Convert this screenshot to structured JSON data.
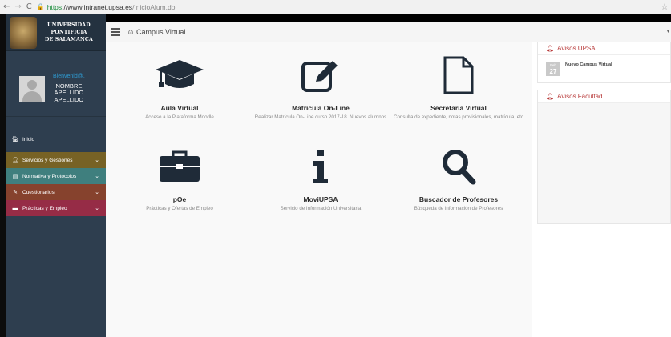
{
  "browser": {
    "back": "←",
    "forward": "→",
    "reload": "C",
    "url_scheme": "https",
    "url_host": "://www.intranet.upsa.es",
    "url_path": "/InicioAlum.do",
    "star_icon": "star-icon"
  },
  "sidebar": {
    "logo": {
      "line1": "UNIVERSIDAD",
      "line2": "PONTIFICIA",
      "line3": "DE SALAMANCA"
    },
    "user": {
      "welcome": "Bienvenid@,",
      "name": "NOMBRE",
      "surname1": "APELLIDO",
      "surname2": "APELLIDO"
    },
    "menu": [
      {
        "label": "Inicio",
        "icon": "home-icon",
        "color": "#2e3e4f"
      },
      {
        "label": "Servicios y Gestiones",
        "icon": "person-icon",
        "color": "#776225"
      },
      {
        "label": "Normativa y Protocolos",
        "icon": "document-icon",
        "color": "#3f7f7e"
      },
      {
        "label": "Cuestionarios",
        "icon": "edit-icon",
        "color": "#86422d"
      },
      {
        "label": "Prácticas y Empleo",
        "icon": "briefcase-icon",
        "color": "#962c46"
      }
    ]
  },
  "header": {
    "title": "Campus Virtual"
  },
  "tiles": [
    {
      "title": "Aula Virtual",
      "desc": "Acceso a la Plataforma Moodle",
      "icon": "graduation-cap-icon"
    },
    {
      "title": "Matrícula On-Line",
      "desc": "Realizar Matrícula On-Line curso 2017-18. Nuevos alumnos",
      "icon": "pencil-square-icon"
    },
    {
      "title": "Secretaría Virtual",
      "desc": "Consulta de expediente, notas provisionales, matrícula, etc",
      "icon": "file-icon"
    },
    {
      "title": "pOe",
      "desc": "Prácticas y Ofertas de Empleo",
      "icon": "briefcase-icon"
    },
    {
      "title": "MoviUPSA",
      "desc": "Servicio de Información Universitaria",
      "icon": "info-icon"
    },
    {
      "title": "Buscador de Profesores",
      "desc": "Búsqueda de información de Profesores",
      "icon": "search-icon"
    }
  ],
  "avisos_upsa": {
    "title": "Avisos UPSA",
    "items": [
      {
        "month": "Feb",
        "day": "27",
        "title": "Nuevo Campus Virtual"
      }
    ]
  },
  "avisos_facultad": {
    "title": "Avisos Facultad"
  },
  "colors": {
    "sidebar_bg": "#2e3e4f",
    "accent_red": "#b83a3a",
    "icon_dark": "#1f2b38"
  }
}
